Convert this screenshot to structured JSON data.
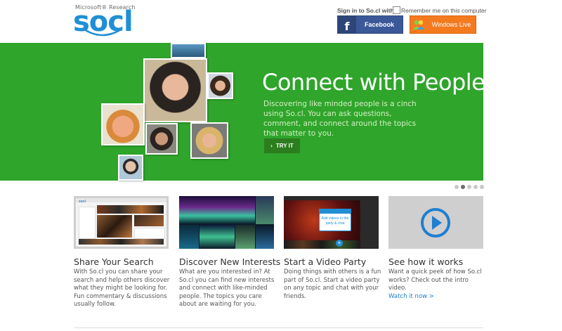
{
  "header": {
    "logo_sub": "Microsoft® Research",
    "logo_main": "socl",
    "signin_label": "Sign in to So.cl with:",
    "remember_label": "Remember me on this computer",
    "facebook_label": "Facebook",
    "windows_live_label": "Windows Live"
  },
  "hero": {
    "title": "Connect with People",
    "text": "Discovering like minded people is a cinch using So.cl. You can ask questions, comment, and connect around the topics that matter to you.",
    "cta_label": "TRY IT",
    "slide_count": 5,
    "active_slide": 2
  },
  "features": [
    {
      "title": "Share Your Search",
      "text": "With So.cl you can share your search and help others discover what they might be looking for. Fun commentary & discussions usually follow.",
      "link": ""
    },
    {
      "title": "Discover New Interests",
      "text": "What are you interested in? At So.cl you can find new interests and connect with like-minded people. The topics you care about are waiting for you.",
      "link": ""
    },
    {
      "title": "Start a Video Party",
      "text": "Doing things with others is a fun part of So.cl. Start a video party on any topic and chat with your friends.",
      "link": "",
      "thumb_popup": "Add videos to the party & chat"
    },
    {
      "title": "See how it works",
      "text": "Want a quick peek of how So.cl works? Check out the intro video.",
      "link": "Watch it now >"
    }
  ],
  "colors": {
    "hero_green": "#2fa52b",
    "brand_blue": "#1f8fd6",
    "facebook_blue": "#3b5998",
    "windows_live_orange": "#f47a20",
    "link_blue": "#1f7fc9"
  }
}
